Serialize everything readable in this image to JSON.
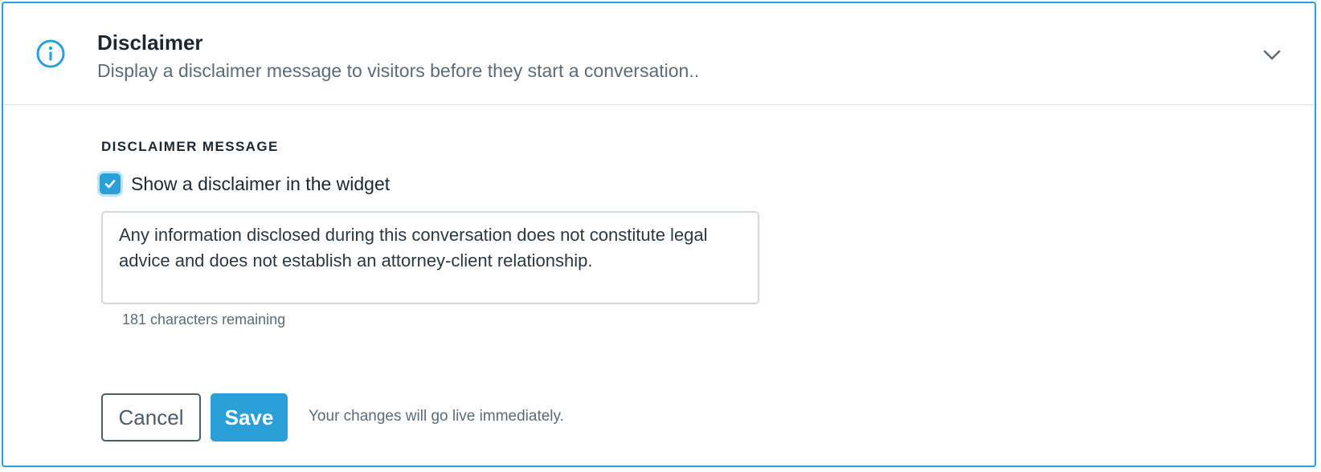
{
  "header": {
    "icon": "info-icon",
    "title": "Disclaimer",
    "subtitle": "Display a disclaimer message to visitors before they start a conversation..",
    "toggle_icon": "chevron-down-icon"
  },
  "form": {
    "section_label": "DISCLAIMER MESSAGE",
    "checkbox": {
      "label": "Show a disclaimer in the widget",
      "checked": true
    },
    "message_value": "Any information disclosed during this conversation does not constitute legal advice and does not establish an attorney-client relationship.",
    "chars_remaining": "181 characters remaining"
  },
  "actions": {
    "cancel_label": "Cancel",
    "save_label": "Save",
    "note": "Your changes will go live immediately."
  },
  "colors": {
    "accent": "#2a9fd8",
    "text": "#1c2730",
    "muted": "#5c6b76"
  }
}
